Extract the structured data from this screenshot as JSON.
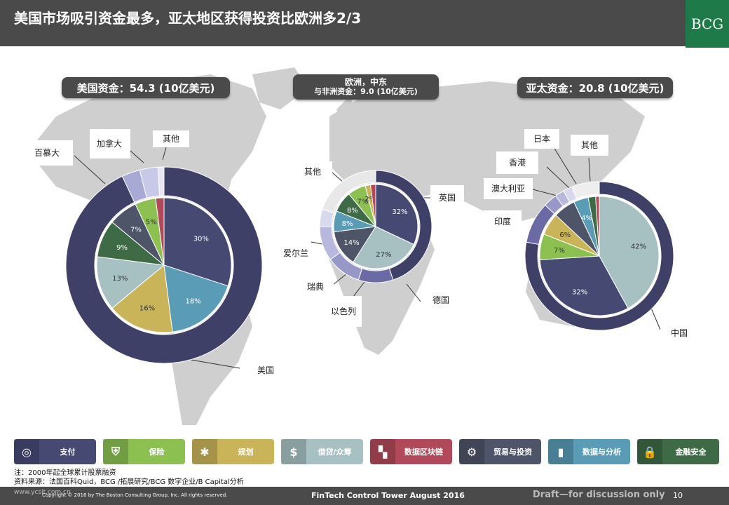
{
  "header": {
    "title": "美国市场吸引资金最多，亚太地区获得投资比欧洲多2/3",
    "logo": "BCG"
  },
  "regions": {
    "us": "美国资金：54.3 (10亿美元)",
    "europe_line1": "欧洲，中东",
    "europe_line2": "与非洲资金：9.0 (10亿美元)",
    "apac": "亚太资金：20.8 (10亿美元)"
  },
  "country_labels": {
    "canada": "加拿大",
    "others_us": "其他",
    "bermuda": "百慕大",
    "usa": "美国",
    "others_eu": "其他",
    "uk": "英国",
    "ireland": "爱尔兰",
    "sweden": "瑞典",
    "israel": "以色列",
    "germany": "德国",
    "japan": "日本",
    "others_ap": "其他",
    "hongkong": "香港",
    "australia": "澳大利亚",
    "india": "印度",
    "china": "中国"
  },
  "colors": {
    "payment": "#464a73",
    "insurance": "#8cc152",
    "planning": "#c9b45a",
    "lending": "#a7c1c3",
    "blockchain": "#b04a5a",
    "trading": "#4e5568",
    "analytics": "#5a9bb5",
    "security": "#3e6a45",
    "map": "#cfcfcf",
    "header": "#4a4a4a",
    "logo": "#1f7a4a"
  },
  "legend": [
    {
      "label": "支付",
      "icon": "coins-icon",
      "color": "#464a73"
    },
    {
      "label": "保险",
      "icon": "shield-icon",
      "color": "#8cc152"
    },
    {
      "label": "规划",
      "icon": "network-icon",
      "color": "#c9b45a"
    },
    {
      "label": "借贷/众筹",
      "icon": "money-bag-icon",
      "color": "#a7c1c3"
    },
    {
      "label": "数据区块链",
      "icon": "blocks-icon",
      "color": "#b04a5a"
    },
    {
      "label": "贸易与投资",
      "icon": "dollar-gear-icon",
      "color": "#4e5568"
    },
    {
      "label": "数据与分析",
      "icon": "bar-chart-icon",
      "color": "#5a9bb5"
    },
    {
      "label": "金融安全",
      "icon": "lock-icon",
      "color": "#3e6a45"
    }
  ],
  "notes": {
    "note": "注：2000年起全球累计股票融资",
    "source": "资料来源：法国百科Quid，BCG /拓展研究/BCG 数字企业/B Capital分析"
  },
  "footer": {
    "copyright": "Copyright © 2016 by The Boston Consulting Group, Inc. All rights reserved.",
    "center": "FinTech Control Tower August 2016",
    "draft": "Draft—for discussion only",
    "page": "10",
    "watermark": "www.ycsit.com.cn"
  },
  "chart_data": [
    {
      "type": "pie",
      "region": "美国",
      "inner": {
        "categories": [
          "支付",
          "数据与分析",
          "规划",
          "借贷/众筹",
          "金融安全",
          "贸易与投资",
          "保险",
          "数据区块链"
        ],
        "values": [
          30,
          18,
          16,
          13,
          9,
          7,
          5,
          2
        ],
        "labels": [
          "30%",
          "18%",
          "16%",
          "13%",
          "9%",
          "7%",
          "5%",
          ""
        ]
      },
      "outer": {
        "categories": [
          "美国",
          "百慕大",
          "加拿大",
          "其他"
        ],
        "values": [
          93,
          3,
          3,
          1
        ]
      }
    },
    {
      "type": "pie",
      "region": "欧洲，中东与非洲",
      "inner": {
        "categories": [
          "支付",
          "借贷/众筹",
          "贸易与投资",
          "数据与分析",
          "金融安全",
          "保险",
          "规划",
          "数据区块链"
        ],
        "values": [
          32,
          27,
          14,
          8,
          8,
          7,
          2,
          2
        ],
        "labels": [
          "32%",
          "27%",
          "14%",
          "8%",
          "8%",
          "7%",
          "2%",
          ""
        ]
      },
      "outer": {
        "categories": [
          "英国",
          "德国",
          "以色列",
          "瑞典",
          "爱尔兰",
          "其他"
        ],
        "values": [
          45,
          10,
          10,
          10,
          5,
          20
        ]
      }
    },
    {
      "type": "pie",
      "region": "亚太",
      "inner": {
        "categories": [
          "借贷/众筹",
          "支付",
          "保险",
          "规划",
          "贸易与投资",
          "数据与分析",
          "金融安全",
          "数据区块链"
        ],
        "values": [
          42,
          32,
          7,
          6,
          6,
          4,
          2,
          1
        ],
        "labels": [
          "42%",
          "32%",
          "7%",
          "6%",
          "",
          "4%",
          "",
          ""
        ]
      },
      "outer": {
        "categories": [
          "中国",
          "印度",
          "澳大利亚",
          "香港",
          "日本",
          "其他"
        ],
        "values": [
          78,
          9,
          3,
          2,
          2,
          6
        ]
      }
    }
  ]
}
